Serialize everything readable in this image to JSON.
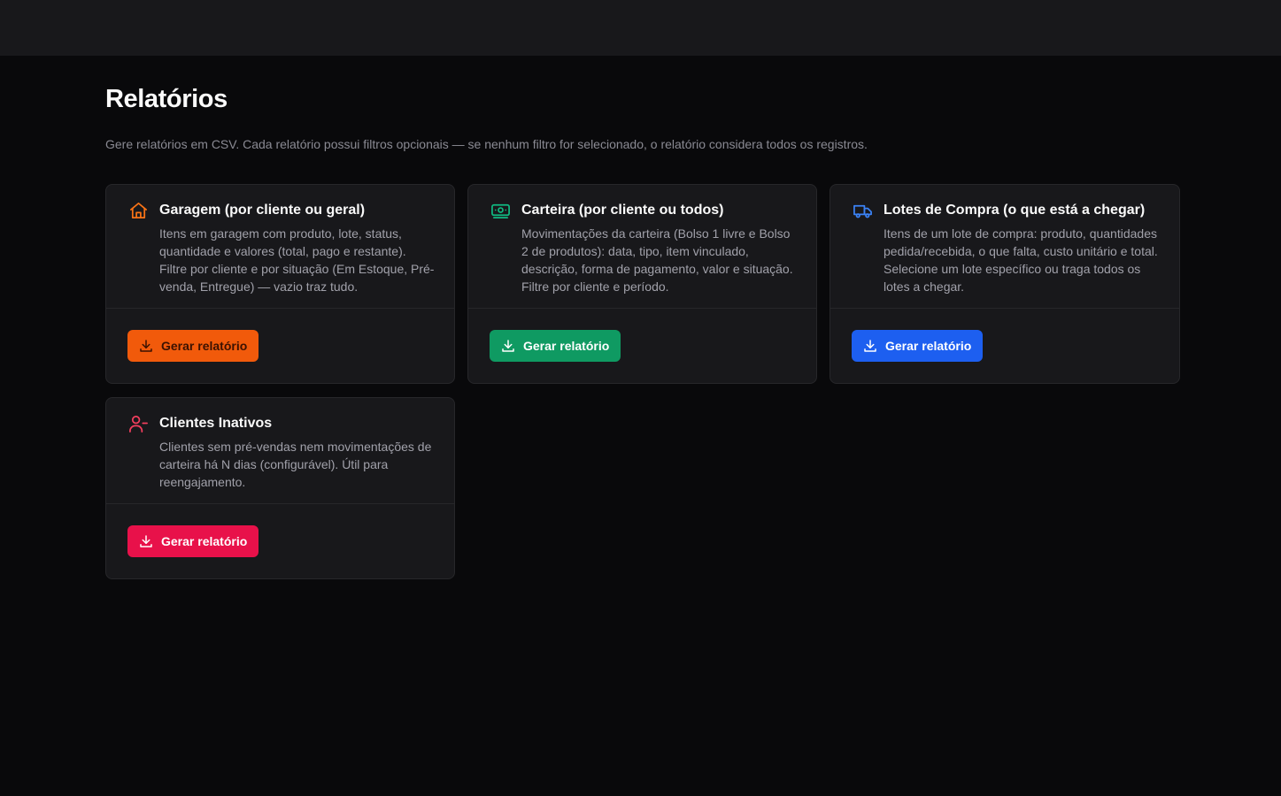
{
  "page": {
    "title": "Relatórios",
    "description": "Gere relatórios em CSV. Cada relatório possui filtros opcionais — se nenhum filtro for selecionado, o relatório considera todos os registros."
  },
  "reports": [
    {
      "icon": "home-icon",
      "icon_color": "#f97316",
      "title": "Garagem (por cliente ou geral)",
      "description": "Itens em garagem com produto, lote, status, quantidade e valores (total, pago e restante). Filtre por cliente e por situação (Em Estoque, Pré-venda, Entregue) — vazio traz tudo.",
      "button_label": "Gerar relatório",
      "button_color": "#f15a0b"
    },
    {
      "icon": "banknote-icon",
      "icon_color": "#10b981",
      "title": "Carteira (por cliente ou todos)",
      "description": "Movimentações da carteira (Bolso 1 livre e Bolso 2 de produtos): data, tipo, item vinculado, descrição, forma de pagamento, valor e situação. Filtre por cliente e período.",
      "button_label": "Gerar relatório",
      "button_color": "#0f9a62"
    },
    {
      "icon": "truck-icon",
      "icon_color": "#3b82f6",
      "title": "Lotes de Compra (o que está a chegar)",
      "description": "Itens de um lote de compra: produto, quantidades pedida/recebida, o que falta, custo unitário e total. Selecione um lote específico ou traga todos os lotes a chegar.",
      "button_label": "Gerar relatório",
      "button_color": "#1d5ff0"
    },
    {
      "icon": "user-minus-icon",
      "icon_color": "#f43f5e",
      "title": "Clientes Inativos",
      "description": "Clientes sem pré-vendas nem movimentações de carteira há N dias (configurável). Útil para reengajamento.",
      "button_label": "Gerar relatório",
      "button_color": "#e8114a"
    }
  ]
}
